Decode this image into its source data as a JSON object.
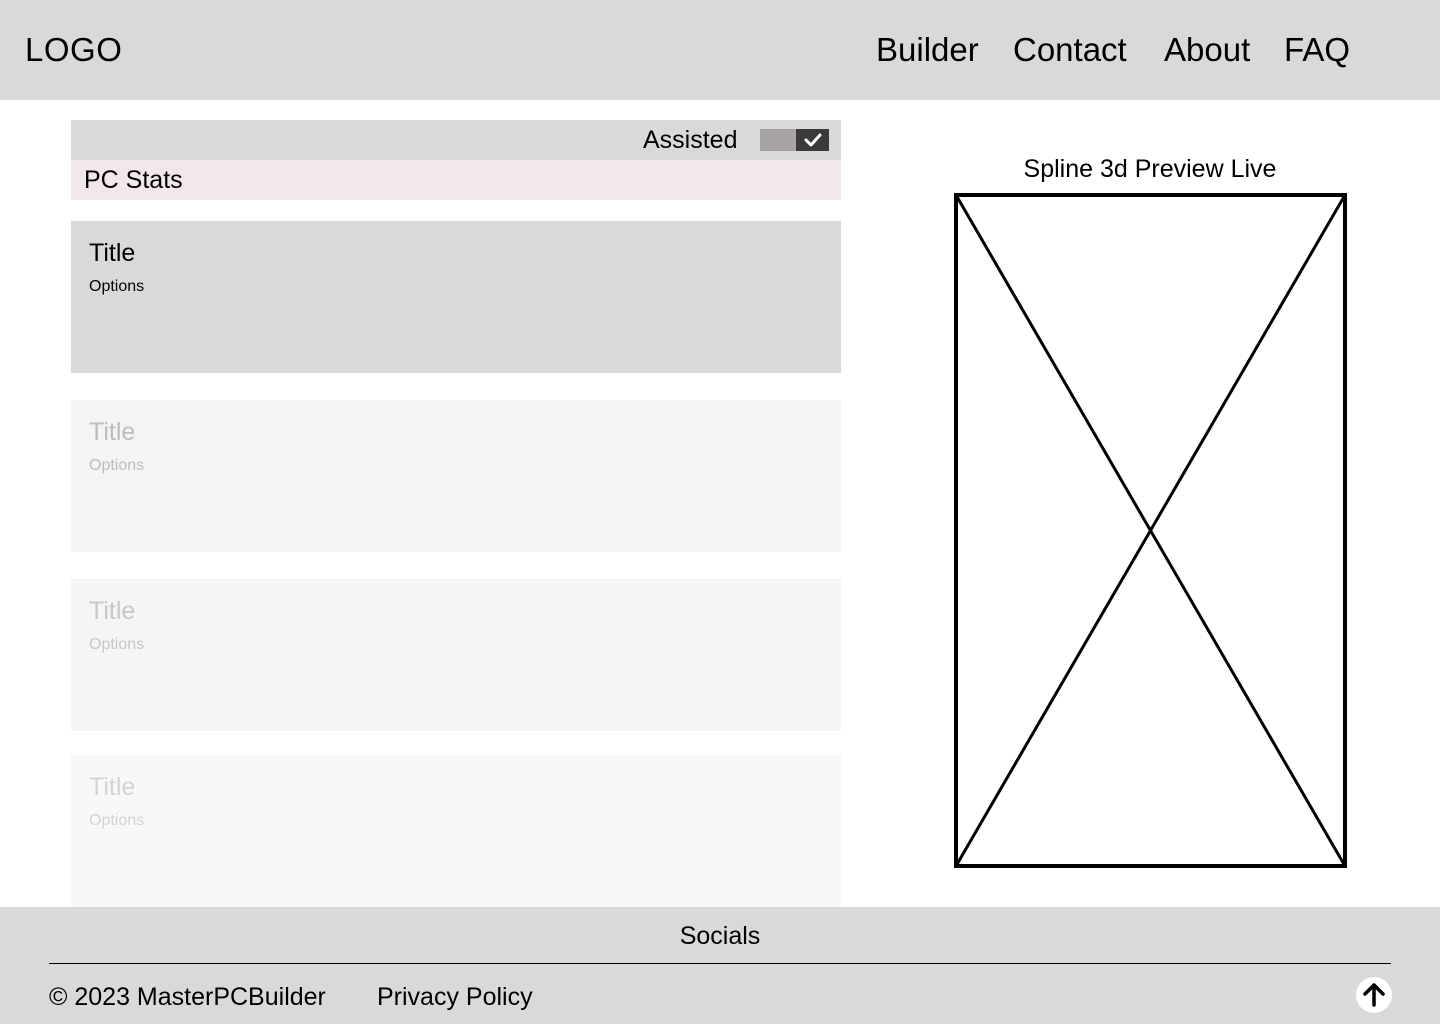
{
  "header": {
    "logo": "LOGO",
    "nav": {
      "builder": "Builder",
      "contact": "Contact",
      "about": "About",
      "faq": "FAQ"
    }
  },
  "builder": {
    "assisted_label": "Assisted",
    "assisted_toggle_on": true,
    "stats_label": "PC Stats",
    "cards": [
      {
        "title": "Title",
        "options": "Options"
      },
      {
        "title": "Title",
        "options": "Options"
      },
      {
        "title": "Title",
        "options": "Options"
      },
      {
        "title": "Title",
        "options": "Options"
      }
    ]
  },
  "preview": {
    "title": "Spline 3d Preview Live"
  },
  "footer": {
    "socials": "Socials",
    "copyright": "© 2023 MasterPCBuilder",
    "privacy": "Privacy Policy"
  },
  "colors": {
    "header_bg": "#d9d9d9",
    "stats_bg": "#f2e8ea",
    "toggle_track": "#a8a4a5",
    "toggle_knob": "#3a3a3a"
  },
  "icons": {
    "toggle_check": "check-icon",
    "scroll_top": "arrow-up-icon",
    "preview_placeholder": "image-placeholder-icon"
  }
}
